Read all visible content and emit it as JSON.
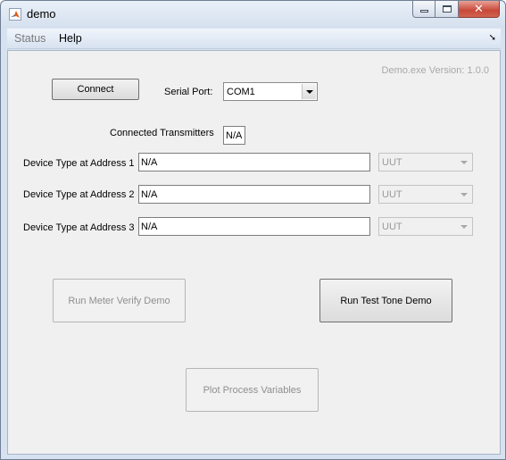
{
  "window": {
    "title": "demo"
  },
  "menubar": {
    "items": [
      "Status",
      "Help"
    ]
  },
  "version_text": "Demo.exe Version: 1.0.0",
  "connect_button": "Connect",
  "serial_port": {
    "label": "Serial Port:",
    "value": "COM1"
  },
  "connected_transmitters": {
    "label": "Connected Transmitters",
    "value": "N/A"
  },
  "devices": [
    {
      "label": "Device Type at Address 1",
      "value": "N/A",
      "type": "UUT"
    },
    {
      "label": "Device Type at Address 2",
      "value": "N/A",
      "type": "UUT"
    },
    {
      "label": "Device Type at Address 3",
      "value": "N/A",
      "type": "UUT"
    }
  ],
  "buttons": {
    "run_meter_verify": "Run Meter Verify Demo",
    "run_test_tone": "Run Test Tone Demo",
    "plot_process_variables": "Plot Process Variables"
  },
  "icons": {
    "app": "matlab-icon",
    "minimize": "minimize-icon",
    "maximize": "maximize-icon",
    "close": "close-icon",
    "menu_arrow": "dock-arrow-icon",
    "dropdown": "chevron-down-icon"
  }
}
